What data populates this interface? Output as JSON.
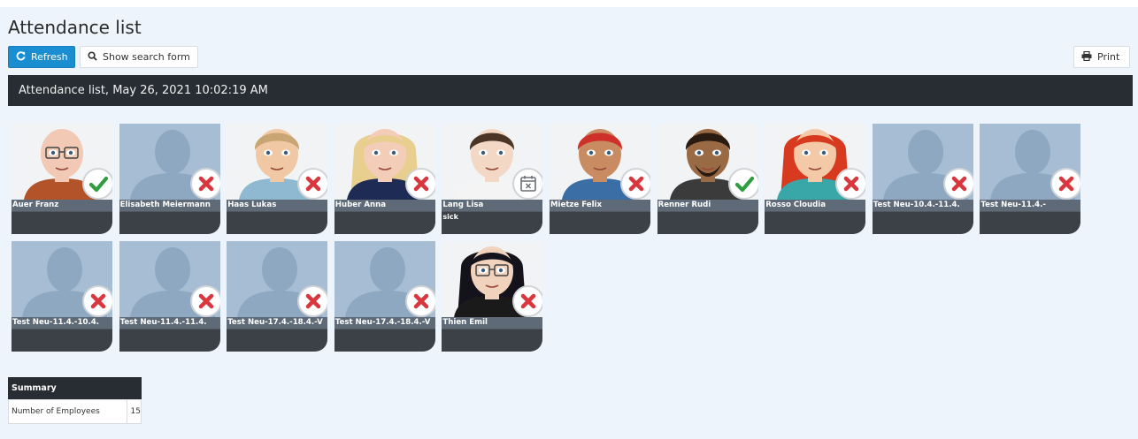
{
  "page": {
    "title": "Attendance list",
    "list_header": "Attendance list, May 26, 2021 10:02:19 AM"
  },
  "toolbar": {
    "refresh_label": "Refresh",
    "refresh_icon": "refresh-icon",
    "search_label": "Show search form",
    "search_icon": "magnifier-icon",
    "print_label": "Print",
    "print_icon": "printer-icon"
  },
  "colors": {
    "accent": "#1b8ed1",
    "header_bg": "#272d33",
    "panel_bg": "#eef4fb",
    "present": "#2e9e3e",
    "absent": "#d9363e"
  },
  "employees": [
    {
      "name": "Auer Franz",
      "status": "present",
      "note": "",
      "avatar": "bald-glasses"
    },
    {
      "name": "Elisabeth Meiermann",
      "status": "absent",
      "note": "",
      "avatar": "silhouette"
    },
    {
      "name": "Haas Lukas",
      "status": "absent",
      "note": "",
      "avatar": "blond-boy"
    },
    {
      "name": "Huber Anna",
      "status": "absent",
      "note": "",
      "avatar": "blonde-woman"
    },
    {
      "name": "Lang Lisa",
      "status": "calendar",
      "note": "sick",
      "avatar": "brunette-woman"
    },
    {
      "name": "Mietze Felix",
      "status": "absent",
      "note": "",
      "avatar": "redhead-man"
    },
    {
      "name": "Renner Rudi",
      "status": "present",
      "note": "",
      "avatar": "dark-man"
    },
    {
      "name": "Rosso Cloudia",
      "status": "absent",
      "note": "",
      "avatar": "redhead-woman"
    },
    {
      "name": "Test Neu-10.4.-11.4.",
      "status": "absent",
      "note": "",
      "avatar": "silhouette"
    },
    {
      "name": "Test Neu-11.4.-",
      "status": "absent",
      "note": "",
      "avatar": "silhouette"
    },
    {
      "name": "Test Neu-11.4.-10.4.",
      "status": "absent",
      "note": "",
      "avatar": "silhouette"
    },
    {
      "name": "Test Neu-11.4.-11.4.",
      "status": "absent",
      "note": "",
      "avatar": "silhouette"
    },
    {
      "name": "Test Neu-17.4.-18.4.-V",
      "status": "absent",
      "note": "",
      "avatar": "silhouette"
    },
    {
      "name": "Test Neu-17.4.-18.4.-V",
      "status": "absent",
      "note": "",
      "avatar": "silhouette"
    },
    {
      "name": "Thien Emil",
      "status": "absent",
      "note": "",
      "avatar": "goth-woman"
    }
  ],
  "summary": {
    "title": "Summary",
    "rows": [
      {
        "label": "Number of Employees",
        "value": "15"
      }
    ]
  }
}
